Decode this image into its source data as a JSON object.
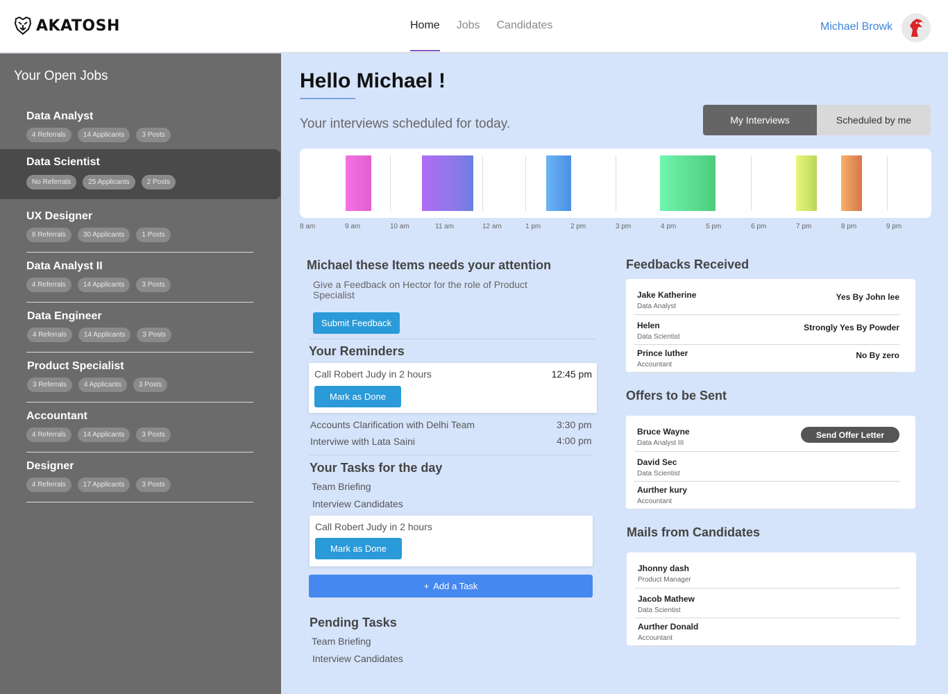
{
  "header": {
    "brand": "AKATOSH",
    "nav": [
      {
        "label": "Home",
        "active": true
      },
      {
        "label": "Jobs",
        "active": false
      },
      {
        "label": "Candidates",
        "active": false
      }
    ],
    "user_name": "Michael Browk",
    "accent_color": "#7a57c9"
  },
  "sidebar": {
    "title": "Your Open Jobs",
    "jobs": [
      {
        "title": "Data Analyst",
        "referrals": "4 Referrals",
        "applicants": "14 Applicants",
        "posts": "3 Posts"
      },
      {
        "title": "Data Scientist",
        "referrals": "No Referrals",
        "applicants": "25 Applicants",
        "posts": "2 Posts",
        "selected": true
      },
      {
        "title": "UX Designer",
        "referrals": "6 Referrals",
        "applicants": "30 Applicants",
        "posts": "1 Posts"
      },
      {
        "title": "Data Analyst II",
        "referrals": "4 Referrals",
        "applicants": "14 Applicants",
        "posts": "3 Posts"
      },
      {
        "title": "Data Engineer",
        "referrals": "4 Referrals",
        "applicants": "14 Applicants",
        "posts": "3 Posts"
      },
      {
        "title": "Product Specialist",
        "referrals": "3 Referrals",
        "applicants": "4 Applicants",
        "posts": "3 Posts"
      },
      {
        "title": "Accountant",
        "referrals": "4 Referrals",
        "applicants": "14 Applicants",
        "posts": "3 Posts"
      },
      {
        "title": "Designer",
        "referrals": "4 Referrals",
        "applicants": "17 Applicants",
        "posts": "3 Posts"
      }
    ]
  },
  "main": {
    "greeting": "Hello Michael !",
    "schedule_text": "Your interviews scheduled for today.",
    "toggle": {
      "active": "My Interviews",
      "inactive": "Scheduled by me"
    },
    "timeline_labels": [
      "8 am",
      "9 am",
      "10 am",
      "11 am",
      "12 am",
      "1 pm",
      "2 pm",
      "3 pm",
      "4 pm",
      "5 pm",
      "6 pm",
      "7 pm",
      "8 pm",
      "9 pm"
    ],
    "timeline_colors": [
      "#f06be0",
      "#a876f5",
      "#5aa7f0",
      "#5ff0a3",
      "#dff07a",
      "#f0a56a"
    ]
  },
  "attention": {
    "title": "Michael these Items needs your attention",
    "text": "Give a Feedback on Hector for the role of Product Specialist",
    "button": "Submit Feedback"
  },
  "reminders": {
    "title": "Your Reminders",
    "card": {
      "text": "Call Robert Judy in 2 hours",
      "time": "12:45 pm",
      "button": "Mark as Done"
    },
    "items": [
      {
        "text": "Accounts Clarification with Delhi Team",
        "time": "3:30 pm"
      },
      {
        "text": "Interviwe with Lata Saini",
        "time": "4:00 pm"
      }
    ]
  },
  "tasks": {
    "title": "Your Tasks for the day",
    "items": [
      "Team Briefing",
      "Interview Candidates"
    ],
    "card": {
      "text": "Call Robert Judy in 2 hours",
      "button": "Mark as Done"
    },
    "add_button": "Add a Task"
  },
  "pending": {
    "title": "Pending Tasks",
    "items": [
      "Team Briefing",
      "Interview Candidates"
    ]
  },
  "feedbacks": {
    "title": "Feedbacks Received",
    "items": [
      {
        "name": "Jake Katherine",
        "role": "Data Analyst",
        "result": "Yes By John lee"
      },
      {
        "name": "Helen",
        "role": "Data Scientist",
        "result": "Strongly Yes By Powder"
      },
      {
        "name": "Prince luther",
        "role": "Accountant",
        "result": "No By zero"
      }
    ]
  },
  "offers": {
    "title": "Offers to be Sent",
    "button": "Send Offer Letter",
    "items": [
      {
        "name": "Bruce Wayne",
        "role": "Data Analyst III"
      },
      {
        "name": "David Sec",
        "role": "Data Scientist"
      },
      {
        "name": "Aurther kury",
        "role": "Accountant"
      }
    ]
  },
  "mails": {
    "title": "Mails from Candidates",
    "items": [
      {
        "name": "Jhonny dash",
        "role": "Product Manager"
      },
      {
        "name": "Jacob Mathew",
        "role": "Data Scientist"
      },
      {
        "name": "Aurther Donald",
        "role": "Accountant"
      }
    ]
  }
}
